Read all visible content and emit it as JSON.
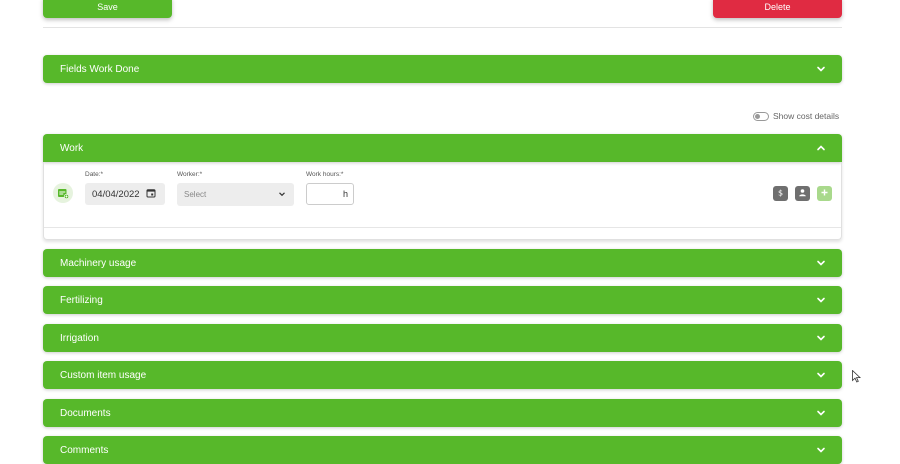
{
  "toolbar": {
    "save_label": "Save",
    "delete_label": "Delete"
  },
  "cost_toggle": {
    "label": "Show cost details",
    "on": false
  },
  "panels": {
    "fields_work_done": "Fields Work Done",
    "work": "Work",
    "machinery": "Machinery usage",
    "fertilizing": "Fertilizing",
    "irrigation": "Irrigation",
    "custom_item": "Custom item usage",
    "documents": "Documents",
    "comments": "Comments"
  },
  "work_form": {
    "date_label": "Date:*",
    "date_value": "04/04/2022",
    "worker_label": "Worker:*",
    "worker_placeholder": "Select",
    "hours_label": "Work hours:*",
    "hours_unit": "h"
  },
  "colors": {
    "accent_green": "#57b82a",
    "danger_red": "#e02b42",
    "action_gray": "#6f6f6f",
    "add_light_green": "#a9d98c"
  },
  "icons": {
    "chevron_down": "chevron-down-icon",
    "chevron_up": "chevron-up-icon",
    "calendar": "calendar-icon",
    "dollar": "dollar-icon",
    "person": "person-icon",
    "plus": "plus-icon"
  }
}
